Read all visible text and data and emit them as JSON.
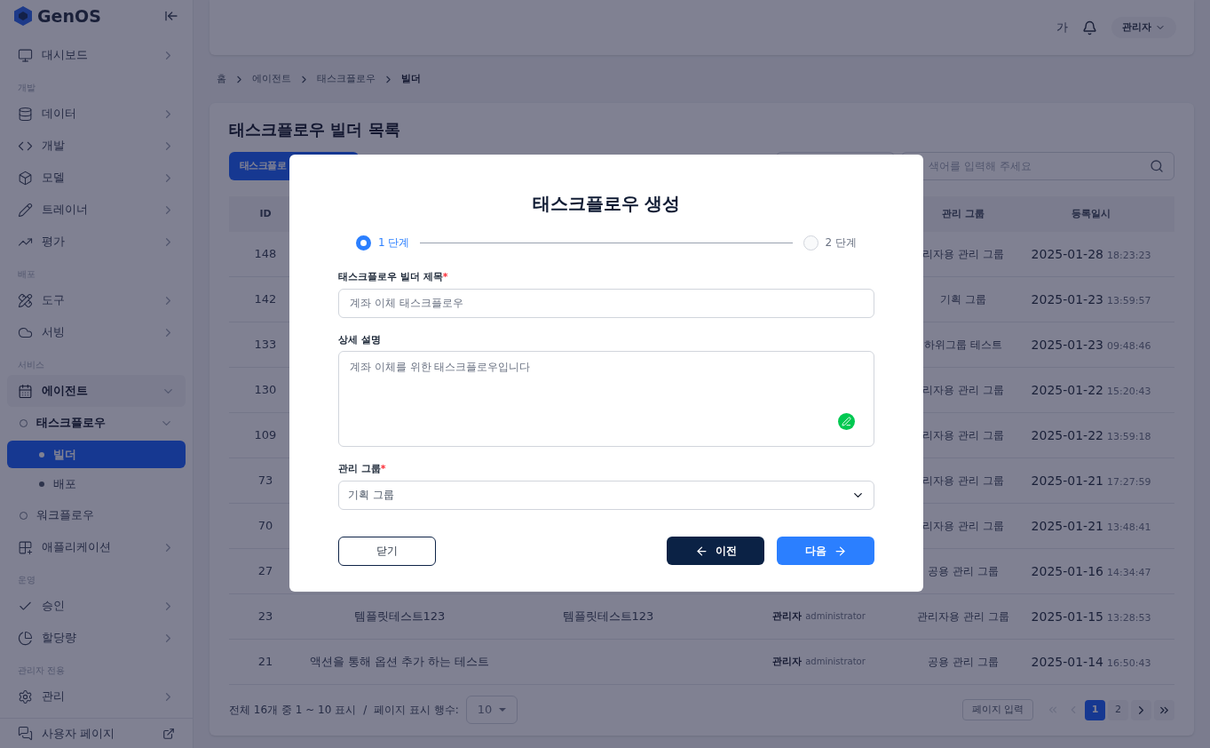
{
  "sidebar": {
    "logo": "GenOS",
    "items": [
      {
        "kind": "item",
        "label": "대시보드",
        "expanded": false
      },
      {
        "kind": "section",
        "label": "개발"
      },
      {
        "kind": "item",
        "label": "데이터",
        "expanded": false
      },
      {
        "kind": "item",
        "label": "개발",
        "expanded": false
      },
      {
        "kind": "item",
        "label": "모델",
        "expanded": false
      },
      {
        "kind": "item",
        "label": "트레이너",
        "expanded": false
      },
      {
        "kind": "item",
        "label": "평가",
        "expanded": false
      },
      {
        "kind": "section",
        "label": "배포"
      },
      {
        "kind": "item",
        "label": "도구",
        "expanded": false
      },
      {
        "kind": "item",
        "label": "서빙",
        "expanded": false
      },
      {
        "kind": "section",
        "label": "서비스"
      },
      {
        "kind": "item",
        "label": "에이전트",
        "expanded": true,
        "children": [
          {
            "label": "태스크플로우",
            "expanded": true,
            "children": [
              {
                "label": "빌더",
                "selected": true
              },
              {
                "label": "배포",
                "selected": false
              }
            ]
          },
          {
            "label": "워크플로우",
            "selected": false
          }
        ]
      },
      {
        "kind": "item",
        "label": "애플리케이션",
        "expanded": false
      },
      {
        "kind": "section",
        "label": "운영"
      },
      {
        "kind": "item",
        "label": "승인",
        "expanded": false
      },
      {
        "kind": "item",
        "label": "할당량",
        "expanded": false
      },
      {
        "kind": "section",
        "label": "관리자 전용"
      },
      {
        "kind": "item",
        "label": "관리",
        "expanded": false
      }
    ],
    "footer": "사용자 페이지"
  },
  "header": {
    "text_size_button": "가",
    "user": "관리자"
  },
  "breadcrumb": [
    "홈",
    "에이전트",
    "태스크플로우",
    "빌더"
  ],
  "page": {
    "title": "태스크플로우 빌더 목록",
    "create_button": "태스크플로",
    "search": {
      "placeholder": "색어를 입력해 주세요"
    }
  },
  "table": {
    "columns": [
      "ID",
      "관리 그룹",
      "등록일시"
    ],
    "rows": [
      {
        "id": "148",
        "group": "리자용 관리 그룹",
        "date": "2025-01-28",
        "time": "18:23:23"
      },
      {
        "id": "142",
        "group": "기획 그룹",
        "date": "2025-01-23",
        "time": "13:59:57"
      },
      {
        "id": "133",
        "group": "하위그룹 테스트",
        "date": "2025-01-23",
        "time": "09:48:46"
      },
      {
        "id": "130",
        "group": "리자용 관리 그룹",
        "date": "2025-01-22",
        "time": "15:20:43"
      },
      {
        "id": "109",
        "group": "리자용 관리 그룹",
        "date": "2025-01-22",
        "time": "13:59:18"
      },
      {
        "id": "73",
        "group": "리자용 관리 그룹",
        "date": "2025-01-21",
        "time": "17:27:59"
      },
      {
        "id": "70",
        "group": "리자용 관리 그룹",
        "date": "2025-01-21",
        "time": "13:48:41"
      },
      {
        "id": "27",
        "group": "공용 관리 그룹",
        "date": "2025-01-16",
        "time": "14:34:47"
      },
      {
        "id": "23",
        "name": "템플릿테스트123",
        "description": "템플릿테스트123",
        "creator": "관리자",
        "creator_id": "administrator",
        "group": "관리자용 관리 그룹",
        "date": "2025-01-15",
        "time": "13:28:53"
      },
      {
        "id": "21",
        "name": "액션을 통해 옵션 추가 하는 테스트",
        "creator": "관리자",
        "creator_id": "administrator",
        "group": "공용 관리 그룹",
        "date": "2025-01-14",
        "time": "16:50:43"
      }
    ]
  },
  "pagination": {
    "summary": "전체 16개 중 1 ~ 10 표시",
    "separator": "/",
    "rows_label": "페이지 표시 행수:",
    "rows_value": "10",
    "page_input": "페이지 입력",
    "pages": [
      {
        "label": "1",
        "selected": true
      },
      {
        "label": "2",
        "selected": false
      }
    ]
  },
  "modal": {
    "title": "태스크플로우 생성",
    "steps": [
      {
        "label": "1 단계",
        "selected": true
      },
      {
        "label": "2 단계",
        "selected": false
      }
    ],
    "fields": [
      {
        "kind": "text",
        "label": "태스크플로우 빌더 제목",
        "mark": "*",
        "placeholder": "계좌 이체 태스크플로우"
      },
      {
        "kind": "textarea",
        "label": "상세 설명",
        "placeholder": "계좌 이체를 위한 태스크플로우입니다"
      },
      {
        "kind": "select",
        "label": "관리 그룹",
        "mark": "*",
        "value": "기획 그룹"
      }
    ],
    "buttons": [
      {
        "kind": "outline",
        "label": "닫기"
      },
      {
        "kind": "prev",
        "label": "이전"
      },
      {
        "kind": "next",
        "label": "다음"
      }
    ]
  }
}
